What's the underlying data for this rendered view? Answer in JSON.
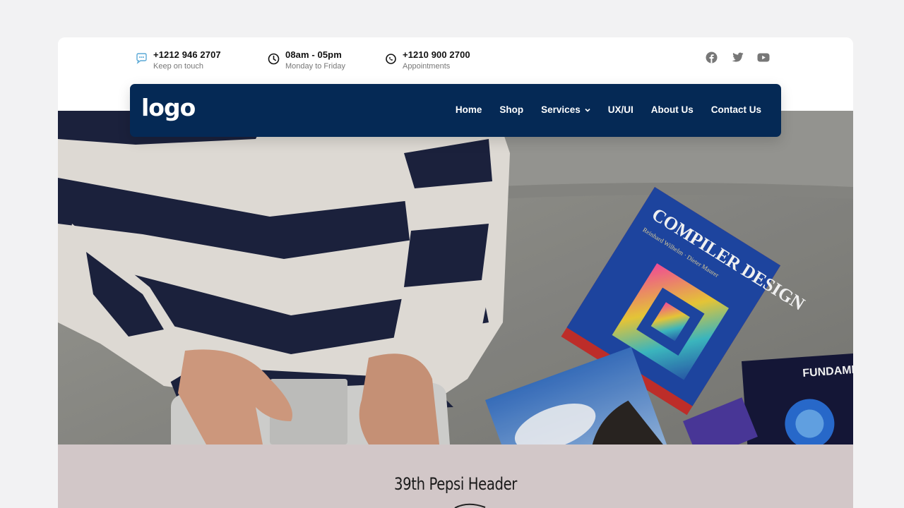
{
  "topbar": {
    "items": [
      {
        "icon": "chat-bubble-icon",
        "main": "+1212 946 2707",
        "sub": "Keep on touch"
      },
      {
        "icon": "clock-icon",
        "main": "08am - 05pm",
        "sub": "Monday to Friday"
      },
      {
        "icon": "phone-icon",
        "main": "+1210 900 2700",
        "sub": "Appointments"
      }
    ],
    "social": [
      "facebook-icon",
      "twitter-icon",
      "youtube-icon"
    ]
  },
  "nav": {
    "logo": "logo",
    "items": [
      {
        "label": "Home"
      },
      {
        "label": "Shop"
      },
      {
        "label": "Services",
        "dropdown": true
      },
      {
        "label": "UX/UI"
      },
      {
        "label": "About Us"
      },
      {
        "label": "Contact Us"
      }
    ],
    "color": "#052955"
  },
  "hero": {
    "book_title": "COMPILER DESIGN",
    "book_authors": "Reinhard Wilhelm · Dieter Maurer",
    "book2_title": "FUNDAME OF COMPUT"
  },
  "section": {
    "title": "39th Pepsi Header",
    "background": "#d2c7c8"
  }
}
